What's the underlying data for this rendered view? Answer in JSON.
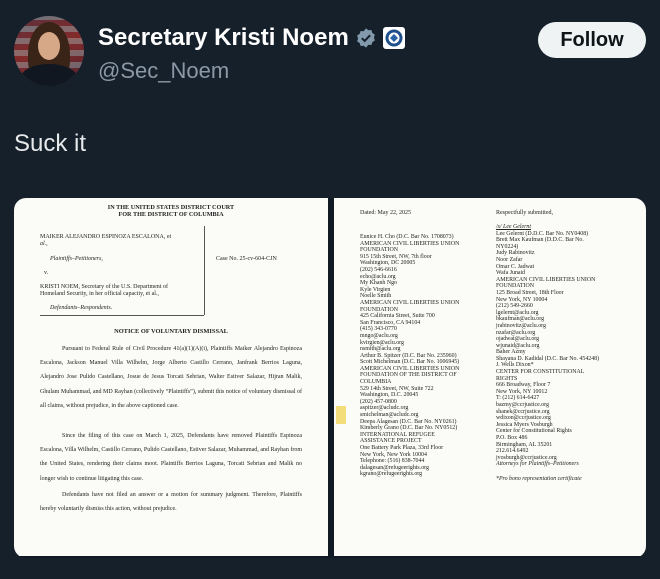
{
  "account": {
    "name": "Secretary Kristi Noem",
    "handle": "@Sec_Noem",
    "follow_label": "Follow",
    "verified_icon": "verified-badge-icon",
    "affiliation_icon": "dhs-seal-icon"
  },
  "tweet": {
    "text": "Suck it"
  },
  "document": {
    "page1": {
      "court_line1": "IN THE UNITED STATES DISTRICT COURT",
      "court_line2": "FOR THE DISTRICT OF COLUMBIA",
      "plaintiff_1": "MAIKER ALEJANDRO ESPINOZA ESCALONA, et",
      "plaintiff_2": "al.,",
      "plaintiff_role": "Plaintiffs–Petitioners,",
      "versus": "v.",
      "case_no": "Case No. 25-cv-604-CJN",
      "defendant_1": "KRISTI NOEM, Secretary of the U.S. Department of",
      "defendant_2": "Homeland Security, in her official capacity, et al.,",
      "defendant_role": "Defendants–Respondents.",
      "title": "NOTICE OF VOLUNTARY DISMISSAL",
      "para1": "Pursuant to Federal Rule of Civil Procedure 41(a)(1)(A)(i), Plaintiffs Maiker Alejandro Espinoza Escalona, Jackson Manuel Villa Wilhelm, Jorge Alberto Castillo Cerrano, Janfrank Berrios Laguna, Alejandro Jose Pulido Castellano, Josue de Jesus Torcati Sebrian, Walter Estiver Salazar, Hijran Malik, Ghulam Muhammad, and MD Rayhan (collectively “Plaintiffs”), submit this notice of voluntary dismissal of all claims, without prejudice, in the above captioned case.",
      "para2": "Since the filing of this case on March 1, 2025, Defendants have removed Plaintiffs Espinoza Escalona, Villa Wilhelm, Castillo Cerrano, Pulido Castellano, Estiver Salazar, Muhammad, and Rayhan from the United States, rendering their claims moot. Plaintiffs Berrios Laguna, Torcati Sebrian and Malik no longer wish to continue litigating this case.",
      "para3": "Defendants have not filed an answer or a motion for summary judgment. Therefore, Plaintiffs hereby voluntarily dismiss this action, without prejudice."
    },
    "page2": {
      "dated": "Dated: May 22, 2025",
      "submitted": "Respectfully submitted,",
      "left_blocks": [
        [
          "Eunice H. Cho (D.C. Bar No. 1708073)",
          "AMERICAN CIVIL LIBERTIES UNION",
          "FOUNDATION",
          "915 15th Street, NW, 7th floor",
          "Washington, DC 20005",
          "(202) 546-6616",
          "echo@aclu.org"
        ],
        [
          "My Khanh Ngo",
          "Kyle Virgien",
          "Noelle Smith",
          "AMERICAN CIVIL LIBERTIES UNION",
          "FOUNDATION",
          "425 California Street, Suite 700",
          "San Francisco, CA 94104",
          "(415) 343-0770",
          "mngo@aclu.org",
          "kvirgien@aclu.org",
          "nsmith@aclu.org"
        ],
        [
          "Arthur B. Spitzer (D.C. Bar No. 235960)",
          "Scott Michelman (D.C. Bar No. 1006945)",
          "AMERICAN CIVIL LIBERTIES UNION",
          "FOUNDATION OF THE DISTRICT OF",
          "COLUMBIA",
          "529 14th Street, NW, Suite 722",
          "Washington, D.C. 20045",
          "(202) 457-0800",
          "aspitzer@acludc.org",
          "smichelman@acludc.org"
        ],
        [
          "Deepa Alagesan (D.C. Bar No. NY0261)",
          "Kimberly Grano (D.C. Bar No. NY0512)",
          "INTERNATIONAL REFUGEE",
          "ASSISTANCE PROJECT",
          "One Battery Park Plaza, 33rd Floor",
          "New York, New York 10004",
          "Telephone: (516) 838-7044",
          "dalagesan@refugeerights.org",
          "kgrano@refugeerights.org"
        ]
      ],
      "signature": "/s/ Lee Gelernt",
      "right_blocks": [
        [
          "Lee Gelernt (D.D.C. Bar No. NY0408)",
          "Brett Max Kaufman (D.D.C. Bar No.",
          "NY0224)",
          "Judy Rabinovitz",
          "Noor Zafar",
          "Omar C. Jadwat",
          "Wafa Junaid",
          "AMERICAN CIVIL LIBERTIES UNION",
          "FOUNDATION",
          "125 Broad Street, 18th Floor",
          "New York, NY 10004",
          "(212) 549-2660",
          "lgelernt@aclu.org",
          "bkaufman@aclu.org",
          "jrabinovitz@aclu.org",
          "nzafar@aclu.org",
          "ojadwat@aclu.org",
          "wjunaid@aclu.org"
        ],
        [
          "Baher Azmy",
          "Shayana D. Kadidal (D.C. Bar No. 454248)",
          "J. Wells Dixon*",
          "CENTER FOR CONSTITUTIONAL",
          "RIGHTS",
          "666 Broadway, Floor 7",
          "New York, NY 10012",
          "T: (212) 614-6427",
          "bazmy@ccrjustice.org",
          "shanek@ccrjustice.org",
          "wdixon@ccrjustice.org"
        ],
        [
          "Jessica Myers Vosburgh",
          "Center for Constitutional Rights",
          "P.O. Box 486",
          "Birmingham, AL 35201",
          "212.614.6492",
          "jvosburgh@ccrjustice.org"
        ]
      ],
      "attorneys_for": "Attorneys for Plaintiffs–Petitioners",
      "pro_bono": "*Pro bono representation certificate"
    }
  },
  "colors": {
    "background": "#15202b",
    "primary_text": "#e7e9ea",
    "secondary_text": "#8b98a5",
    "verified": "#829aab",
    "follow_bg": "#eff3f4"
  }
}
